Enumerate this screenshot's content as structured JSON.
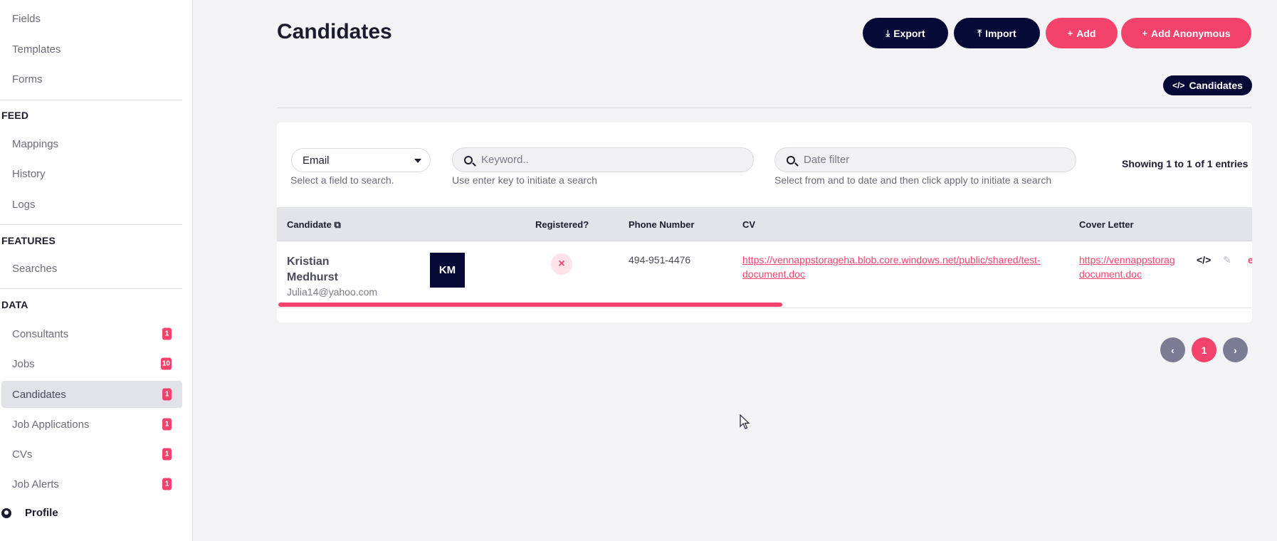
{
  "sidebar": {
    "items_top": [
      {
        "label": "Fields"
      },
      {
        "label": "Templates"
      },
      {
        "label": "Forms"
      }
    ],
    "feed": {
      "heading": "FEED",
      "items": [
        {
          "label": "Mappings"
        },
        {
          "label": "History"
        },
        {
          "label": "Logs"
        }
      ]
    },
    "features": {
      "heading": "FEATURES",
      "items": [
        {
          "label": "Searches"
        }
      ]
    },
    "data": {
      "heading": "DATA",
      "items": [
        {
          "label": "Consultants",
          "badge": "1"
        },
        {
          "label": "Jobs",
          "badge": "10"
        },
        {
          "label": "Candidates",
          "badge": "1"
        },
        {
          "label": "Job Applications",
          "badge": "1"
        },
        {
          "label": "CVs",
          "badge": "1"
        },
        {
          "label": "Job Alerts",
          "badge": "1"
        }
      ]
    },
    "profile_label": "Profile"
  },
  "header": {
    "title": "Candidates",
    "buttons": {
      "export": "Export",
      "import": "Import",
      "add": "Add",
      "add_anonymous": "Add Anonymous"
    },
    "embed_label": "Candidates"
  },
  "filters": {
    "field_select": {
      "value": "Email",
      "hint": "Select a field to search."
    },
    "keyword": {
      "placeholder": "Keyword..",
      "hint": "Use enter key to initiate a search"
    },
    "date": {
      "placeholder": "Date filter",
      "hint": "Select from and to date and then click apply to initiate a search"
    },
    "entries_text": "Showing 1 to 1 of 1 entries"
  },
  "table": {
    "columns": {
      "candidate": "Candidate",
      "registered": "Registered?",
      "phone": "Phone Number",
      "cv": "CV",
      "cover_letter": "Cover Letter"
    },
    "rows": [
      {
        "name": "Kristian Medhurst",
        "email": "Julia14@yahoo.com",
        "avatar_initials": "KM",
        "registered": "×",
        "phone": "494-951-4476",
        "cv_line1": "https://vennappstorageha.blob.core.windows.net/public/shared/test-",
        "cv_line2": "document.doc",
        "cover_line1": "https://vennappstorag",
        "cover_line2": "document.doc"
      }
    ]
  },
  "pagination": {
    "current_page": "1",
    "prev": "‹",
    "next": "›"
  },
  "colors": {
    "accent": "#f3436d",
    "dark": "#070a36"
  }
}
